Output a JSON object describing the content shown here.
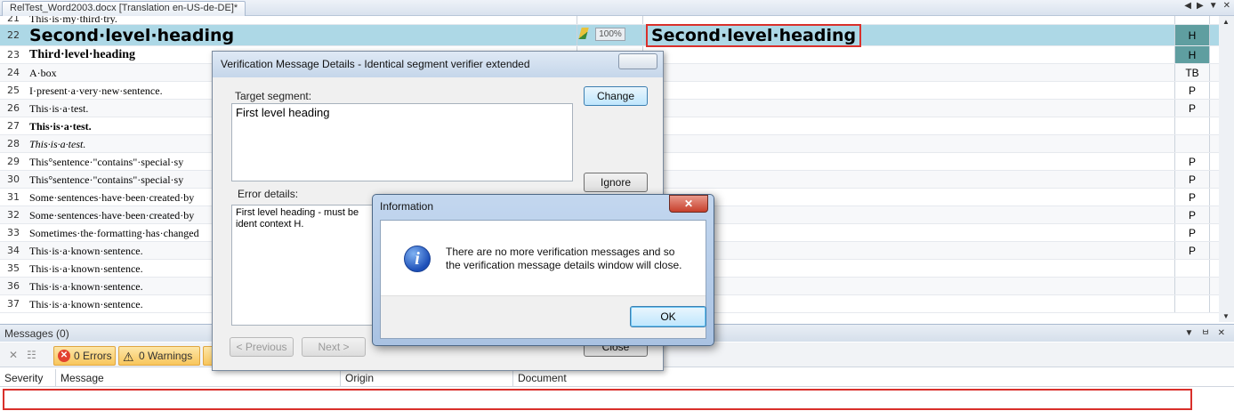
{
  "document_tab": {
    "title": "RelTest_Word2003.docx [Translation en-US-de-DE]*"
  },
  "tab_controls": {
    "prev": "◀",
    "next": "▶",
    "menu": "▼",
    "close": "✕"
  },
  "editor": {
    "partial_row_text": "This·is·my·third·try.",
    "rows": [
      {
        "num": "21",
        "source": "This·is·my·third·try.",
        "style": "P"
      },
      {
        "num": "22",
        "source": "Second·level·heading",
        "status": "100%",
        "target": "Second·level·heading",
        "style": "H"
      },
      {
        "num": "23",
        "source": "Third·level·heading",
        "style": "H"
      },
      {
        "num": "24",
        "source": "A·box",
        "style": "TB"
      },
      {
        "num": "25",
        "source": "I·present·a·very·new·sentence.",
        "style": "P"
      },
      {
        "num": "26",
        "source": "This·is·a·test.",
        "style": "P"
      },
      {
        "num": "27",
        "source": "This·is·a·test.",
        "style": ""
      },
      {
        "num": "28",
        "source": "This·is·a·test.",
        "style": ""
      },
      {
        "num": "29",
        "source": "This°sentence·\"contains\"·special·sy",
        "style": "P"
      },
      {
        "num": "30",
        "source": "This°sentence·\"contains\"·special·sy",
        "style": "P"
      },
      {
        "num": "31",
        "source": "Some·sentences·have·been·created·by",
        "style": "P"
      },
      {
        "num": "32",
        "source": "Some·sentences·have·been·created·by",
        "style": "P"
      },
      {
        "num": "33",
        "source": "Sometimes·the·formatting·has·changed",
        "style": "P"
      },
      {
        "num": "34",
        "source": "This·is·a·known·sentence.",
        "style": "P"
      },
      {
        "num": "35",
        "source": "This·is·a·known·sentence.",
        "style": ""
      },
      {
        "num": "36",
        "source": "This·is·a·known·sentence.",
        "style": ""
      },
      {
        "num": "37",
        "source": "This·is·a·known·sentence.",
        "style": ""
      }
    ]
  },
  "messages_panel": {
    "title": "Messages (0)",
    "errors_label": "0 Errors",
    "warnings_label": "0 Warnings",
    "columns": [
      "Severity",
      "Message",
      "Origin",
      "Document"
    ]
  },
  "verification_dialog": {
    "title": "Verification Message Details - Identical segment verifier extended",
    "target_label": "Target segment:",
    "target_text": "First level heading",
    "error_label": "Error details:",
    "error_text": "First level heading - must be ident context H.",
    "change_button": "Change",
    "ignore_button": "Ignore",
    "previous_button": "< Previous",
    "next_button": "Next >",
    "close_button": "Close"
  },
  "info_dialog": {
    "title": "Information",
    "message_line1": "There are no more verification messages and so",
    "message_line2": "the verification message details window will close.",
    "ok_button": "OK",
    "close_glyph": "✕"
  },
  "colors": {
    "selected_row": "#add8e6",
    "highlight_border": "#d9302b",
    "style_teal": "#5f9ea0"
  }
}
